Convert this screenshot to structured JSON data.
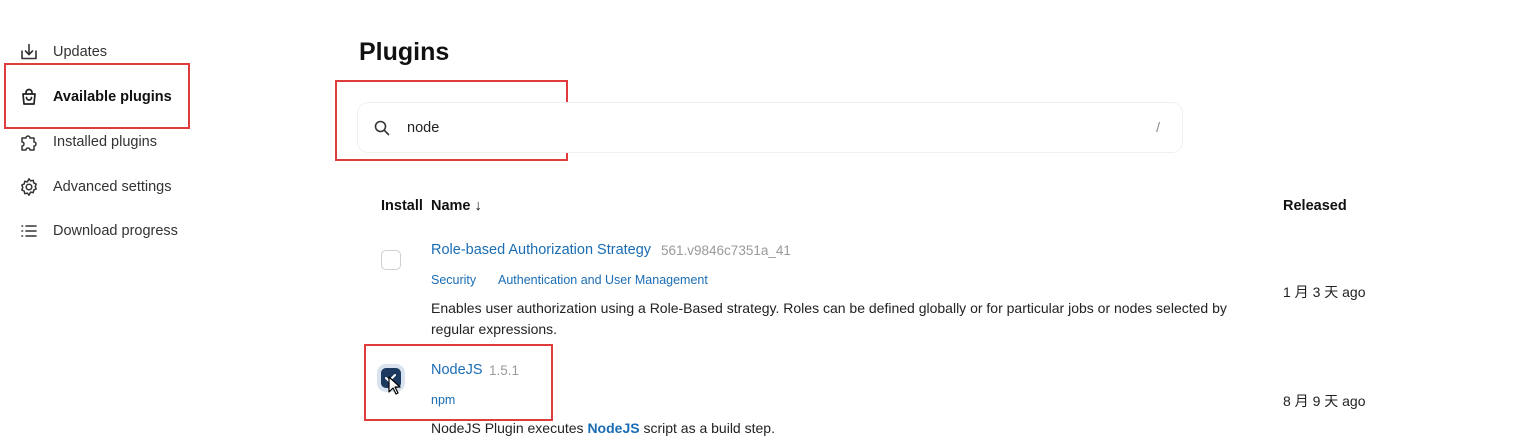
{
  "sidebar": {
    "items": [
      {
        "label": "Updates",
        "icon": "download-icon"
      },
      {
        "label": "Available plugins",
        "icon": "shopping-bag-icon"
      },
      {
        "label": "Installed plugins",
        "icon": "puzzle-icon"
      },
      {
        "label": "Advanced settings",
        "icon": "gear-icon"
      },
      {
        "label": "Download progress",
        "icon": "list-icon"
      }
    ]
  },
  "main": {
    "title": "Plugins",
    "search": {
      "value": "node",
      "shortcut": "/"
    },
    "table": {
      "headers": {
        "install": "Install",
        "name": "Name ↓",
        "released": "Released"
      },
      "rows": [
        {
          "name": "Role-based Authorization Strategy",
          "version": "561.v9846c7351a_41",
          "tags": [
            "Security",
            "Authentication and User Management"
          ],
          "description_line1": "Enables user authorization using a Role-Based strategy. Roles can be defined globally or for particular jobs or nodes selected by",
          "description_line2": "regular expressions.",
          "released": "1 月 3 天 ago",
          "checked": false
        },
        {
          "name": "NodeJS",
          "version": "1.5.1",
          "tags": [
            "npm"
          ],
          "description_pre": "NodeJS Plugin executes ",
          "description_link": "NodeJS",
          "description_post": " script as a build step.",
          "released": "8 月 9 天 ago",
          "checked": true
        }
      ]
    }
  },
  "colors": {
    "highlight": "#e03c3c",
    "link": "#1a6db5",
    "checkbox_checked": "#1c3a5f"
  }
}
